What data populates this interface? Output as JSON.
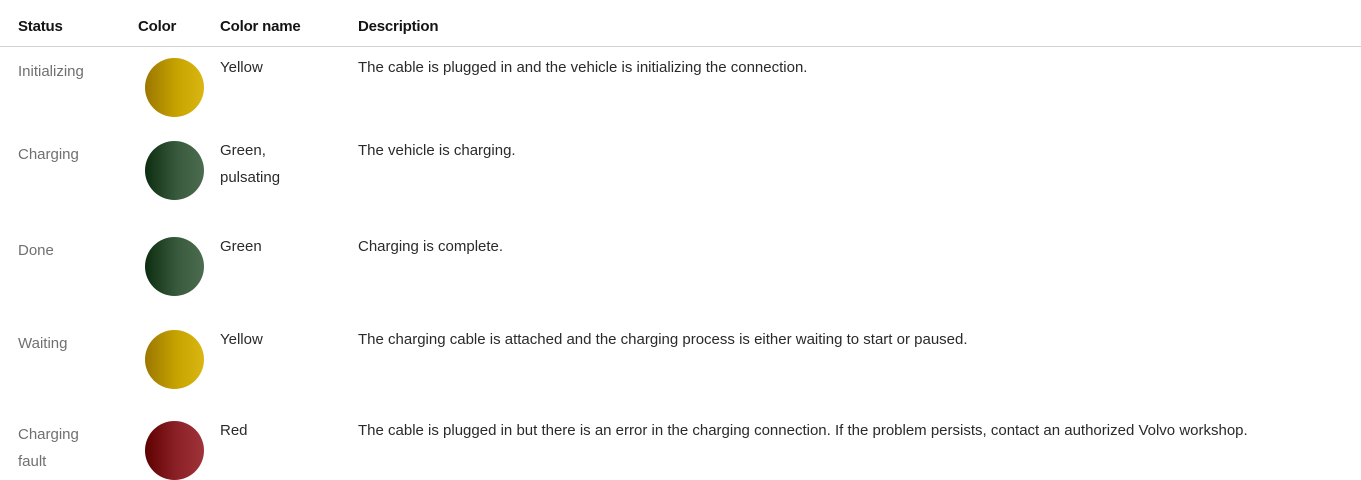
{
  "columns": {
    "status": "Status",
    "color": "Color",
    "color_name": "Color name",
    "description": "Description"
  },
  "rows": [
    {
      "status": "Initializing",
      "color_name": "Yellow",
      "color_hex": "#c8a400",
      "description": "The cable is plugged in and the vehicle is initializing the connection."
    },
    {
      "status": "Charging",
      "color_name": "Green, pulsating",
      "color_hex": "#3a5a3d",
      "description": "The vehicle is charging."
    },
    {
      "status": "Done",
      "color_name": "Green",
      "color_hex": "#3a5a3d",
      "description": "Charging is complete."
    },
    {
      "status": "Waiting",
      "color_name": "Yellow",
      "color_hex": "#c8a400",
      "description": "The charging cable is attached and the charging process is either waiting to start or paused."
    },
    {
      "status": "Charging fault",
      "color_name": "Red",
      "color_hex": "#8c2228",
      "description": "The cable is plugged in but there is an error in the charging connection. If the problem persists, contact an authorized Volvo workshop."
    }
  ]
}
